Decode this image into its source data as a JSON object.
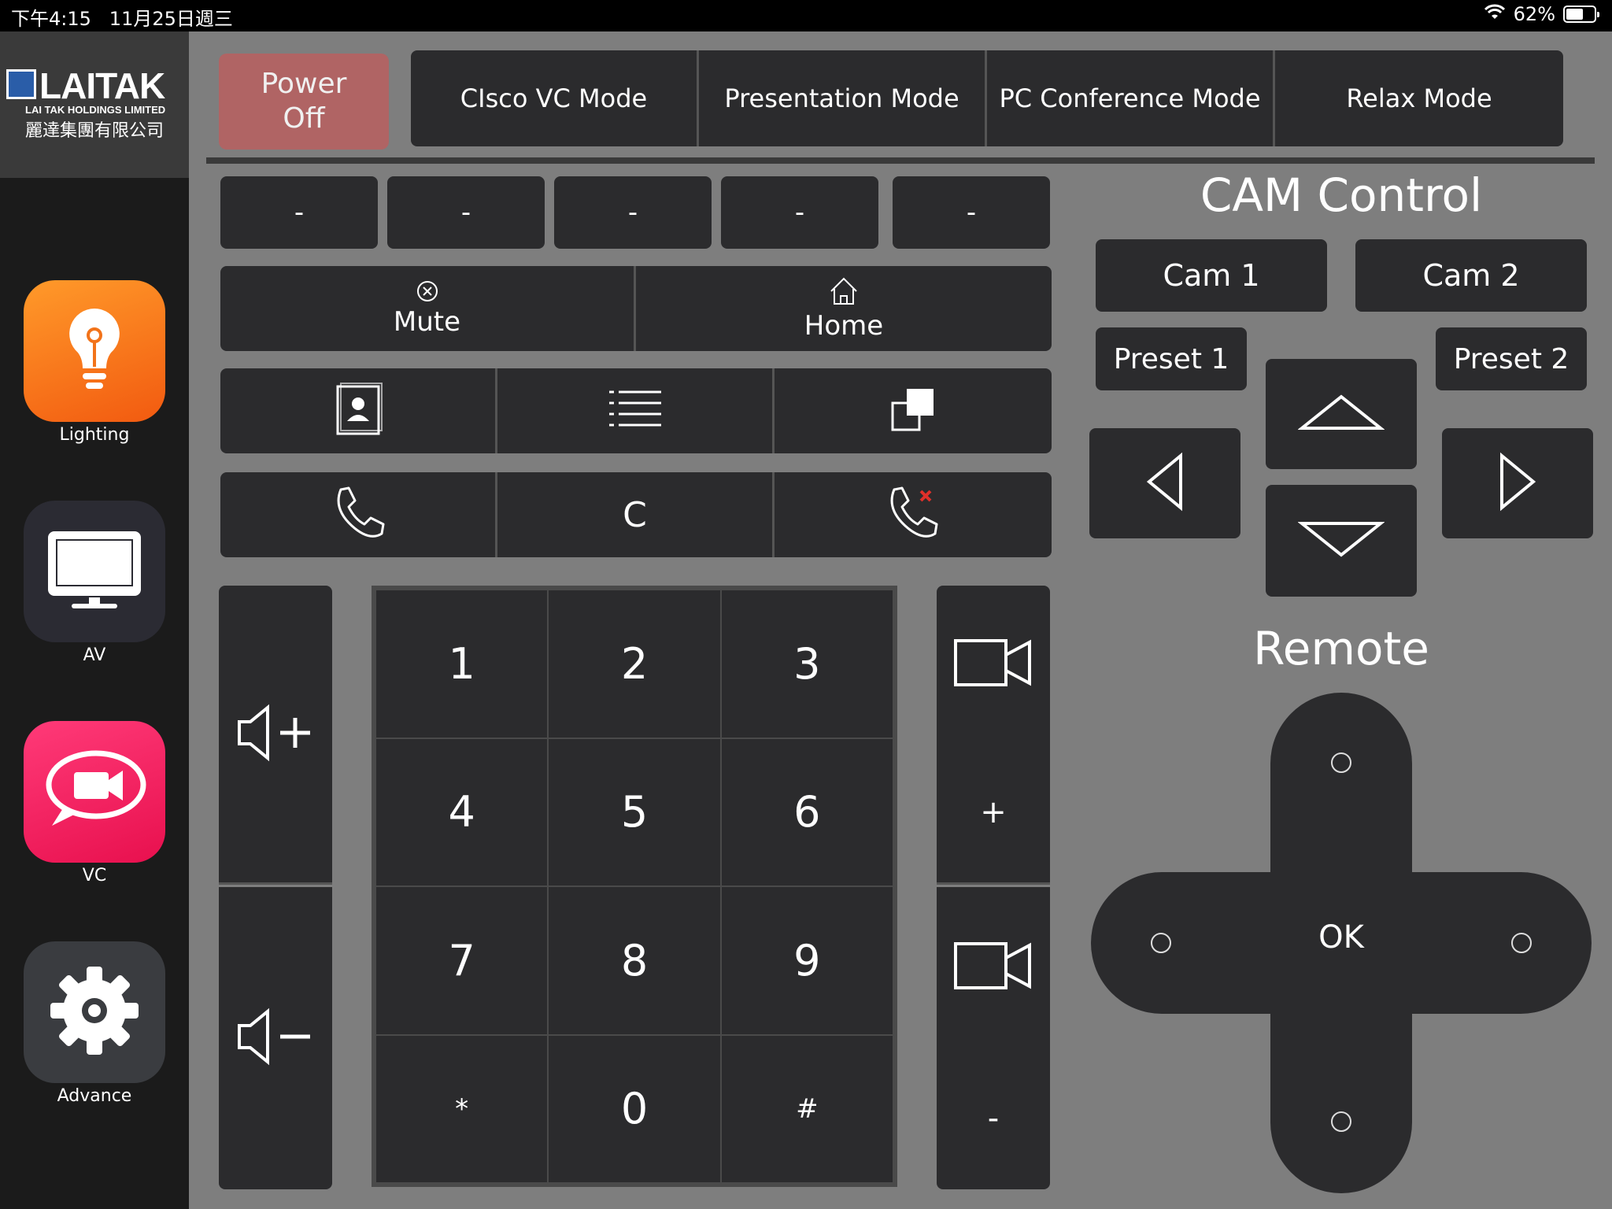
{
  "status": {
    "time": "下午4:15",
    "date": "11月25日週三",
    "battery": "62%",
    "battery_level": 0.62
  },
  "logo": {
    "word": "LAITAK",
    "sub": "LAI TAK HOLDINGS LIMITED",
    "cn": "麗達集團有限公司"
  },
  "apps": [
    {
      "label": "Lighting",
      "icon": "lightbulb-icon"
    },
    {
      "label": "AV",
      "icon": "monitor-icon"
    },
    {
      "label": "VC",
      "icon": "video-chat-icon"
    },
    {
      "label": "Advance",
      "icon": "gear-icon"
    }
  ],
  "power": {
    "line1": "Power",
    "line2": "Off"
  },
  "modes": [
    "CIsco VC  Mode",
    "Presentation Mode",
    "PC Conference Mode",
    "Relax Mode"
  ],
  "dash_buttons": [
    "-",
    "-",
    "-",
    "-",
    "-"
  ],
  "mute_label": "Mute",
  "home_label": "Home",
  "clear_label": "C",
  "keypad": [
    "1",
    "2",
    "3",
    "4",
    "5",
    "6",
    "7",
    "8",
    "9",
    "*",
    "0",
    "#"
  ],
  "cam_plus": "+",
  "cam_minus": "-",
  "cam_control": {
    "title": "CAM Control",
    "cam1": "Cam 1",
    "cam2": "Cam 2",
    "preset1": "Preset 1",
    "preset2": "Preset 2"
  },
  "remote": {
    "title": "Remote",
    "ok": "OK"
  },
  "colors": {
    "background": "#7e7e7e",
    "button": "#2b2b2d",
    "power": "#b06464",
    "sidebar": "#1b1b1b"
  }
}
